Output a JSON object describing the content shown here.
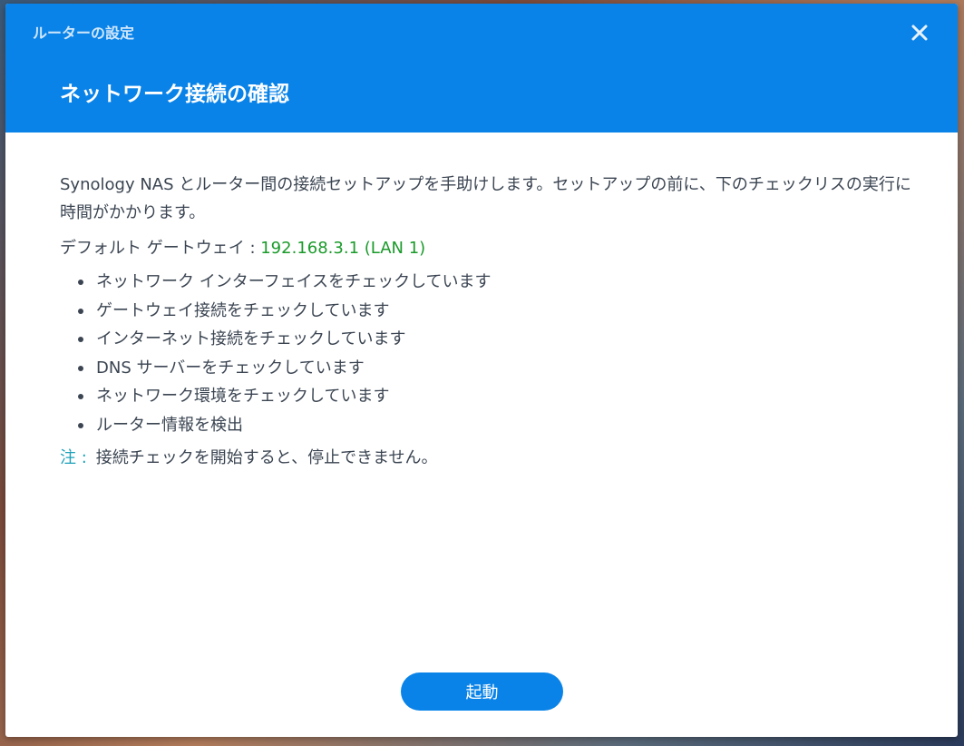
{
  "window": {
    "title": "ルーターの設定",
    "close_icon": "close-icon"
  },
  "page": {
    "title": "ネットワーク接続の確認"
  },
  "content": {
    "intro": "Synology NAS とルーター間の接続セットアップを手助けします。セットアップの前に、下のチェックリスの実行に時間がかかります。",
    "gateway_label": "デフォルト ゲートウェイ : ",
    "gateway_value": "192.168.3.1 (LAN 1)",
    "checklist": [
      "ネットワーク インターフェイスをチェックしています",
      "ゲートウェイ接続をチェックしています",
      "インターネット接続をチェックしています",
      "DNS サーバーをチェックしています",
      "ネットワーク環境をチェックしています",
      "ルーター情報を検出"
    ],
    "note_label": "注 :",
    "note_text": "接続チェックを開始すると、停止できません。"
  },
  "footer": {
    "start_label": "起動"
  },
  "colors": {
    "header": "#0a83e8",
    "gateway_value": "#1a9a2a",
    "note_label": "#1ca0b8",
    "button": "#0a83e8"
  }
}
